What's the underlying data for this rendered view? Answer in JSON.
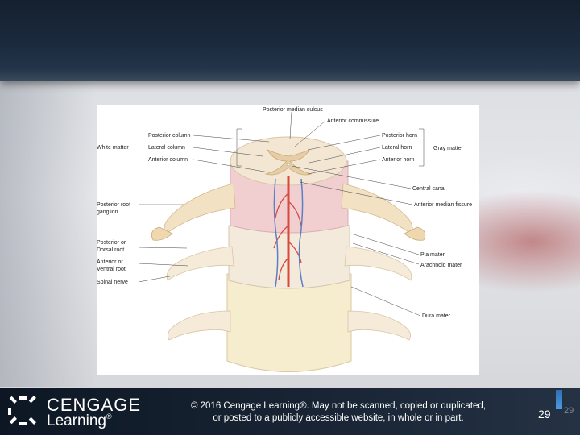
{
  "figure": {
    "labels": {
      "posterior_median_sulcus": "Posterior median sulcus",
      "anterior_commissure": "Anterior commissure",
      "posterior_column": "Posterior column",
      "lateral_column": "Lateral column",
      "anterior_column": "Anterior column",
      "white_matter": "White matter",
      "posterior_horn": "Posterior horn",
      "lateral_horn": "Lateral horn",
      "anterior_horn": "Anterior horn",
      "gray_matter": "Gray matter",
      "central_canal": "Central canal",
      "anterior_median_fissure": "Anterior median fissure",
      "posterior_root_ganglion_1": "Posterior root",
      "posterior_root_ganglion_2": "ganglion",
      "posterior_dorsal_root_1": "Posterior or",
      "posterior_dorsal_root_2": "Dorsal root",
      "anterior_ventral_root_1": "Anterior or",
      "anterior_ventral_root_2": "Ventral root",
      "spinal_nerve": "Spinal nerve",
      "pia_mater": "Pia mater",
      "arachnoid_mater": "Arachnoid mater",
      "dura_mater": "Dura mater"
    }
  },
  "footer": {
    "logo_word1": "CENGAGE",
    "logo_word2": "Learning",
    "logo_tm": "®",
    "copyright_line1": "© 2016 Cengage Learning®. May not be scanned, copied or duplicated,",
    "copyright_line2": "or posted to a publicly accessible website, in whole or in part.",
    "page_number": "29",
    "page_number_small": "29"
  },
  "colors": {
    "top_band": "#1b2a3d",
    "bottom_bar": "#1a2636",
    "accent": "#3a84cf"
  }
}
